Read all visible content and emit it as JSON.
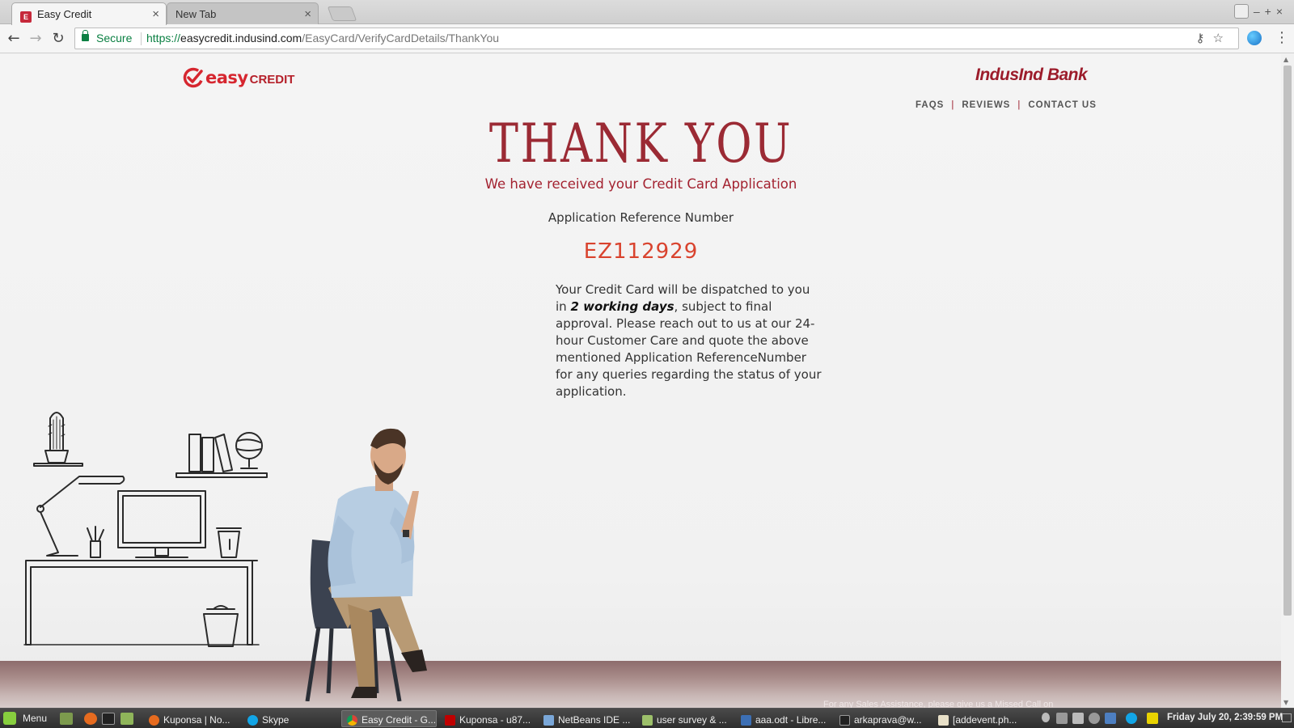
{
  "browser": {
    "tabs": [
      {
        "title": "Easy Credit",
        "active": true
      },
      {
        "title": "New Tab",
        "active": false
      }
    ],
    "security_label": "Secure",
    "url_scheme": "https://",
    "url_host": "easycredit.indusind.com",
    "url_path": "/EasyCard/VerifyCardDetails/ThankYou"
  },
  "header": {
    "logo_easy": "easy",
    "logo_credit": "CREDIT",
    "bank_name": "IndusInd Bank",
    "nav": [
      "FAQS",
      "REVIEWS",
      "CONTACT US"
    ]
  },
  "main": {
    "heading": "THANK YOU",
    "subheading": "We have received your Credit Card Application",
    "reference_label": "Application Reference Number",
    "reference_number": "EZ112929",
    "message_before": "Your Credit Card will be dispatched to you in ",
    "message_emphasis": "2 working days",
    "message_after": ", subject to final approval. Please reach out to us at our 24-hour Customer Care and quote the above mentioned Application ReferenceNumber for any queries regarding the status of your application."
  },
  "footer_note": "For any Sales Assistance, please give us a Missed Call on",
  "taskbar": {
    "menu_label": "Menu",
    "tasks": [
      {
        "label": "Kuponsa | No...",
        "active": false
      },
      {
        "label": "Skype",
        "active": false
      },
      {
        "label": "Easy Credit - G...",
        "active": true
      },
      {
        "label": "Kuponsa - u87...",
        "active": false
      },
      {
        "label": "NetBeans IDE ...",
        "active": false
      },
      {
        "label": "user survey & ...",
        "active": false
      },
      {
        "label": "aaa.odt - Libre...",
        "active": false
      },
      {
        "label": "arkaprava@w...",
        "active": false
      },
      {
        "label": "[addevent.ph...",
        "active": false
      }
    ],
    "clock": "Friday July 20,  2:39:59 PM"
  },
  "colors": {
    "brand_red": "#9b2a34",
    "reference_orange": "#d9432e",
    "secure_green": "#0b8043"
  }
}
